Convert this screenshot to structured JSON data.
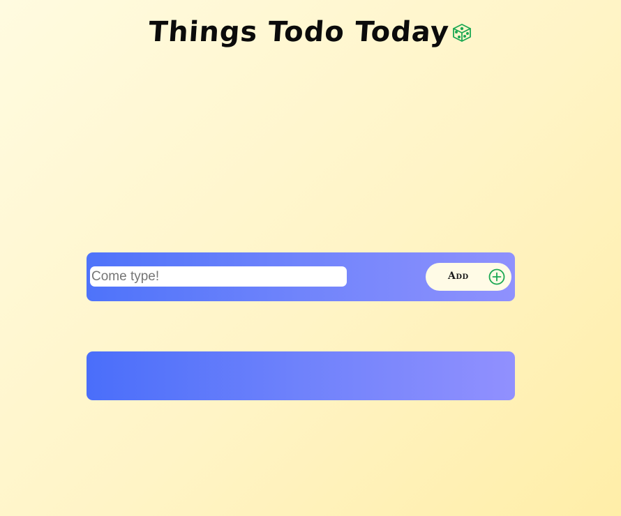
{
  "header": {
    "title": "Things Todo Today",
    "icon": "dice-icon",
    "icon_color": "#1aa852"
  },
  "input_panel": {
    "placeholder": "Come type!",
    "value": "",
    "add_label": "Add",
    "add_icon": "plus-circle-icon",
    "add_icon_color": "#1aa852"
  },
  "todo_list": {
    "items": []
  },
  "colors": {
    "background": "#fff4c6",
    "panel_gradient_start": "#4e73fa",
    "panel_gradient_end": "#8f91fd",
    "button_bg": "#fffbe6"
  }
}
